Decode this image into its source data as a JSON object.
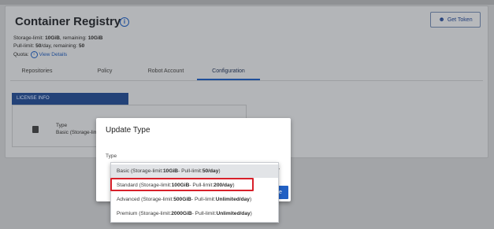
{
  "header": {
    "title": "Container Registry",
    "get_token_label": "Get Token",
    "storage_line": {
      "p1": "Storage-limit: ",
      "v1": "10GiB",
      "p2": ", remaining: ",
      "v2": "10GiB"
    },
    "pull_line": {
      "p1": "Pull-limit: ",
      "v1": "50",
      "p2": "/day, remaining: ",
      "v2": "50"
    },
    "quota_label": "Quota:",
    "view_details": "View Details"
  },
  "tabs": [
    {
      "label": "Repositories"
    },
    {
      "label": "Policy"
    },
    {
      "label": "Robot Account"
    },
    {
      "label": "Configuration",
      "active": true
    }
  ],
  "license": {
    "header": "LICENSE INFO",
    "type_label": "Type",
    "type_value": "Basic (Storage-limi"
  },
  "modal": {
    "title": "Update Type",
    "type_label": "Type",
    "button_partial": "te",
    "options": [
      {
        "prefix": "Basic (Storage-limit:",
        "storage": "10GiB",
        "mid": "- Pull-limit:",
        "pull": "50/day",
        "suffix": ")",
        "selected": true
      },
      {
        "prefix": "Standard (Storage-limit:",
        "storage": "100GiB",
        "mid": "- Pull-limit:",
        "pull": "200/day",
        "suffix": ")",
        "highlighted": true
      },
      {
        "prefix": "Advanced (Storage-limit:",
        "storage": "500GiB",
        "mid": "- Pull-limit:",
        "pull": "Unlimited/day",
        "suffix": ")"
      },
      {
        "prefix": "Premium (Storage-limit:",
        "storage": "2000GiB",
        "mid": "- Pull-limit:",
        "pull": "Unlimited/day",
        "suffix": ")"
      }
    ]
  },
  "colors": {
    "accent": "#1e4f9a",
    "highlight": "#d8202a",
    "primary_button": "#2160c4"
  },
  "icons": [
    "info-icon",
    "person-icon",
    "document-icon",
    "chevron-down-icon"
  ]
}
